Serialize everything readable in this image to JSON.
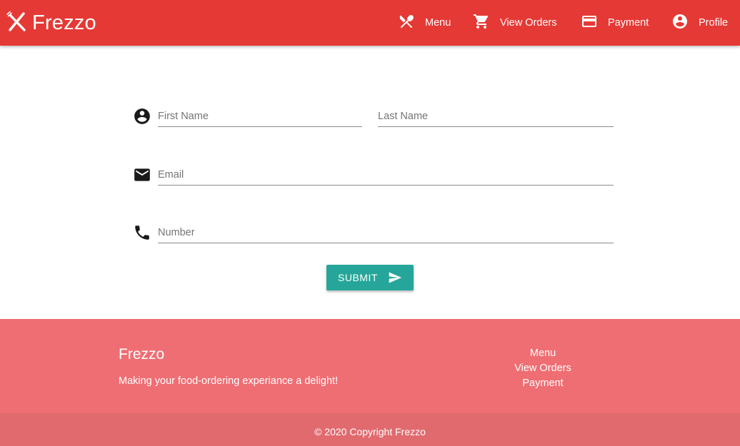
{
  "app": {
    "brand_icon": "fork-knife-icon",
    "brand_name": "Frezzo"
  },
  "nav": {
    "items": [
      {
        "label": "Menu",
        "icon": "fork-spoon-icon"
      },
      {
        "label": "View Orders",
        "icon": "cart-icon"
      },
      {
        "label": "Payment",
        "icon": "credit-card-icon"
      },
      {
        "label": "Profile",
        "icon": "account-circle-icon"
      }
    ]
  },
  "form": {
    "first_name": {
      "placeholder": "First Name",
      "value": "",
      "icon": "account-circle-icon"
    },
    "last_name": {
      "placeholder": "Last Name",
      "value": ""
    },
    "email": {
      "placeholder": "Email",
      "value": "",
      "icon": "mail-icon"
    },
    "number": {
      "placeholder": "Number",
      "value": "",
      "icon": "phone-icon"
    },
    "submit": {
      "label": "SUBMIT",
      "icon": "send-icon"
    }
  },
  "footer": {
    "title": "Frezzo",
    "tagline": "Making your food-ordering experiance a delight!",
    "links": [
      "Menu",
      "View Orders",
      "Payment"
    ],
    "copyright": "© 2020 Copyright Frezzo"
  },
  "colors": {
    "primary": "#e53935",
    "accent": "#26a69a",
    "footer": "#ef6e73",
    "footer_bottom": "#e16a6f"
  }
}
